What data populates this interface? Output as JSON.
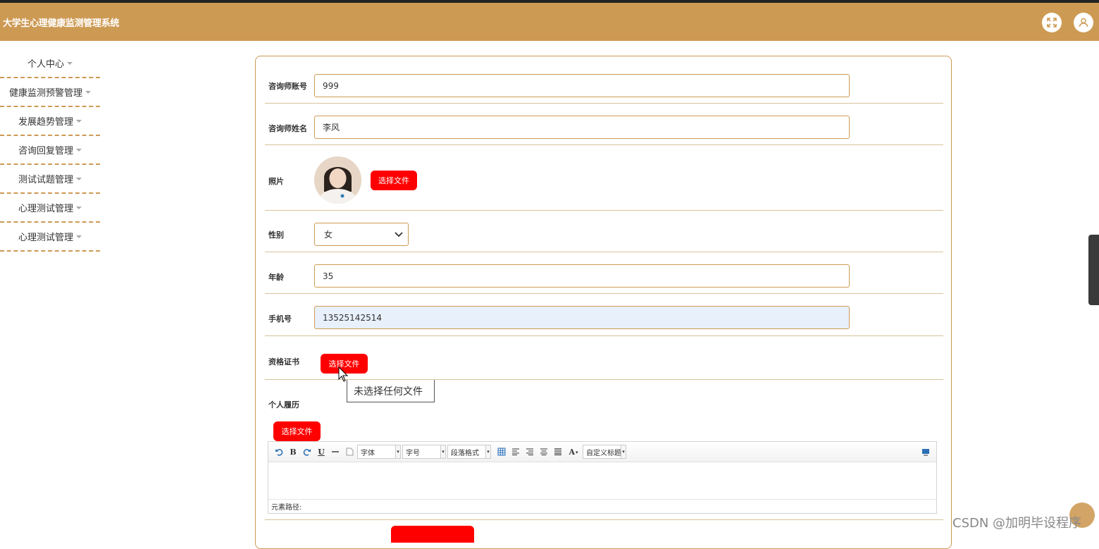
{
  "header": {
    "title": "大学生心理健康监测管理系统",
    "fullscreen_icon": "fullscreen-icon",
    "user_icon": "user-icon",
    "bg_color": "#cd9a54"
  },
  "sidebar": {
    "items": [
      {
        "label": "个人中心"
      },
      {
        "label": "健康监测预警管理"
      },
      {
        "label": "发展趋势管理"
      },
      {
        "label": "咨询回复管理"
      },
      {
        "label": "测试试题管理"
      },
      {
        "label": "心理测试管理"
      },
      {
        "label": "心理测试管理"
      }
    ]
  },
  "form": {
    "account": {
      "label": "咨询师账号",
      "value": "999"
    },
    "name": {
      "label": "咨询师姓名",
      "value": "李风"
    },
    "photo": {
      "label": "照片",
      "button": "选择文件"
    },
    "gender": {
      "label": "性别",
      "value": "女"
    },
    "age": {
      "label": "年龄",
      "value": "35"
    },
    "phone": {
      "label": "手机号",
      "value": "13525142514"
    },
    "certificate": {
      "label": "资格证书",
      "button": "选择文件",
      "tooltip": "未选择任何文件"
    },
    "resume": {
      "label": "个人履历",
      "button": "选择文件"
    }
  },
  "editor": {
    "font_combo": "字体",
    "size_combo": "字号",
    "paragraph_combo": "段落格式",
    "custom_title_combo": "自定义标题",
    "element_path": "元素路径:"
  },
  "watermark": "CSDN @加明毕设程序",
  "accent_red": "#ff0000"
}
